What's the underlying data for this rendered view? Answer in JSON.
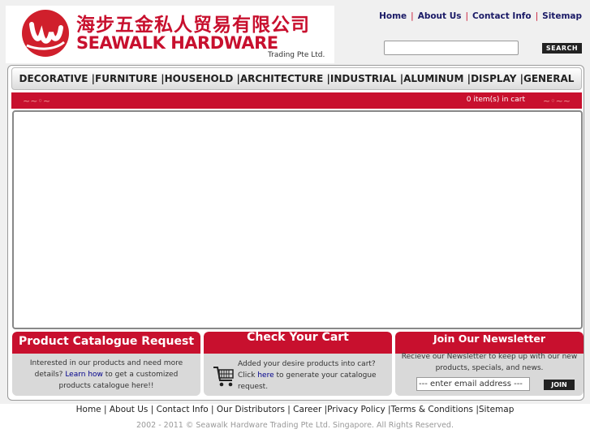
{
  "header": {
    "logo_cn": "海步五金私人贸易有限公司",
    "logo_en": "SEAWALK HARDWARE",
    "logo_sub": "Trading Pte Ltd.",
    "top_links": [
      "Home",
      "About Us",
      "Contact Info",
      "Sitemap"
    ],
    "search_button": "SEARCH",
    "search_value": ""
  },
  "nav": {
    "items": [
      "DECORATIVE",
      "FURNITURE",
      "HOUSEHOLD",
      "ARCHITECTURE",
      "INDUSTRIAL",
      "ALUMINUM",
      "DISPLAY",
      "GENERAL"
    ]
  },
  "cart_bar": {
    "text": "0 item(s) in cart"
  },
  "panels": {
    "catalogue": {
      "title": "Product Catalogue Request",
      "text_before": "Interested in our products and need more details?",
      "link": "Learn how",
      "text_after": "to get a customized products catalogue here!!"
    },
    "cart": {
      "title": "Check Your Cart",
      "text_before": "Added your desire products into cart? Click",
      "link": "here",
      "text_after": "to generate your catalogue request."
    },
    "newsletter": {
      "title": "Join Our Newsletter",
      "text": "Recieve our Newsletter to keep up with our new products, specials, and news.",
      "input_value": "--- enter email address ---",
      "button": "JOIN"
    }
  },
  "footer": {
    "links": [
      "Home",
      "About Us",
      "Contact Info",
      "Our Distributors",
      "Career",
      "Privacy Policy",
      "Terms & Conditions",
      "Sitemap"
    ],
    "copyright": "2002 - 2011 © Seawalk Hardware Trading Pte Ltd. Singapore. All Rights Reserved."
  },
  "colors": {
    "brand_red": "#c8102e",
    "panel_gray": "#d9d9d9",
    "link_blue": "#00008b"
  },
  "icons": [
    "logo-mark",
    "cart-icon",
    "swirl-ornament"
  ]
}
